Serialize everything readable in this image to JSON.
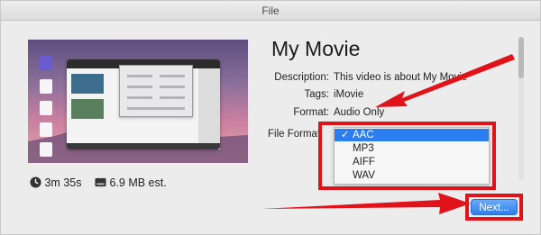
{
  "window": {
    "title": "File"
  },
  "movie": {
    "title": "My Movie"
  },
  "stats": {
    "duration": "3m 35s",
    "size": "6.9 MB est."
  },
  "fields": {
    "description_label": "Description:",
    "description_value": "This video is about My Movie",
    "tags_label": "Tags:",
    "tags_value": "iMovie",
    "format_label": "Format:",
    "format_value": "Audio Only",
    "file_format_label": "File Format"
  },
  "file_format_menu": {
    "selected": "AAC",
    "options": [
      "AAC",
      "MP3",
      "AIFF",
      "WAV"
    ]
  },
  "buttons": {
    "next": "Next..."
  },
  "colors": {
    "annotation_red": "#e0121a",
    "accent_blue": "#2c7ef0"
  },
  "icons": {
    "duration": "clock-icon",
    "size": "disk-icon",
    "selected_mark": "checkmark-icon"
  }
}
